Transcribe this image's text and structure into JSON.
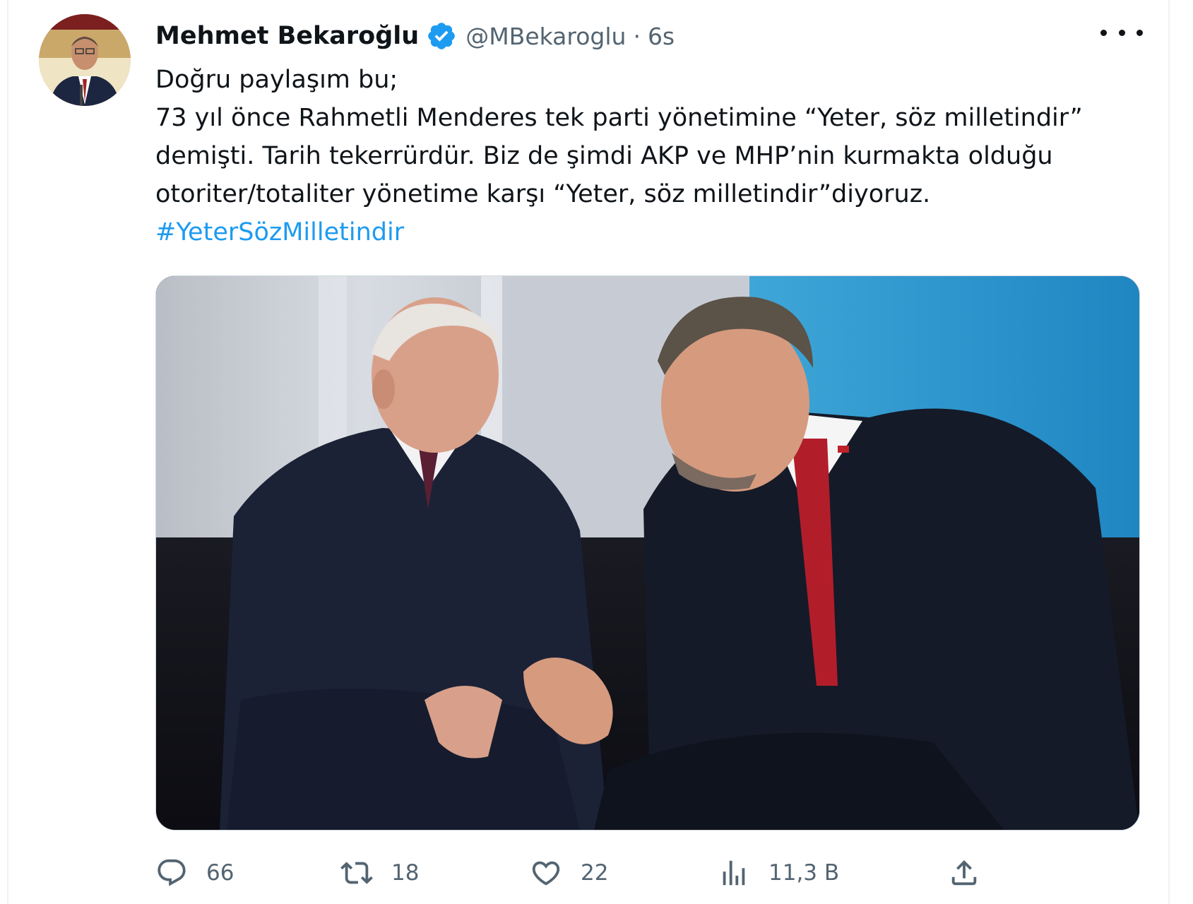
{
  "tweet": {
    "display_name": "Mehmet Bekaroğlu",
    "handle": "@MBekaroglu",
    "separator": "·",
    "time": "6s",
    "lines": [
      "Doğru paylaşım bu;",
      "73 yıl önce Rahmetli Menderes tek parti yönetimine “Yeter, söz milletindir”",
      "demişti. Tarih tekerrürdür. Biz de şimdi AKP ve MHP’nin kurmakta olduğu",
      "otoriter/totaliter yönetime karşı “Yeter, söz milletindir”diyoruz."
    ],
    "hashtag": "#YeterSözMilletindir"
  },
  "metrics": {
    "replies": "66",
    "retweets": "18",
    "likes": "22",
    "views": "11,3 B"
  },
  "icons": {
    "verified": "verified-badge-icon",
    "more": "more-icon",
    "reply": "reply-icon",
    "retweet": "retweet-icon",
    "like": "heart-icon",
    "views": "views-icon",
    "share": "share-icon"
  },
  "colors": {
    "link": "#1d9bf0",
    "muted": "#536471",
    "text": "#0f1419"
  }
}
